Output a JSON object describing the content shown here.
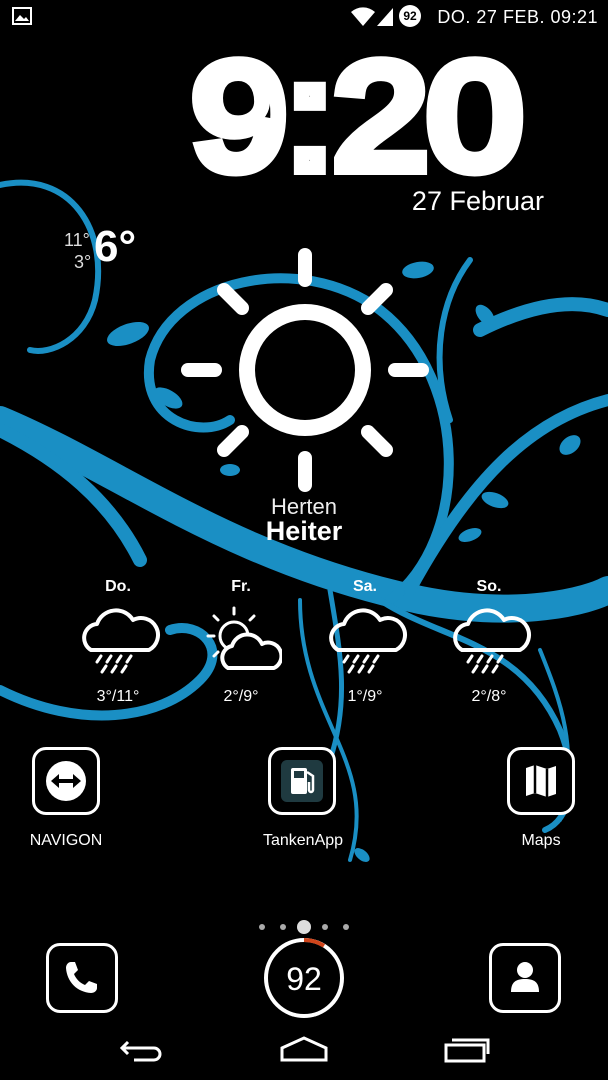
{
  "status_bar": {
    "battery_level": "92",
    "datetime": "DO. 27 FEB. 09:21"
  },
  "clock": {
    "time": "9:20",
    "date": "27 Februar"
  },
  "temperature": {
    "high": "11°",
    "low": "3°",
    "current": "6°"
  },
  "weather": {
    "location": "Herten",
    "condition": "Heiter",
    "icon": "sun-icon"
  },
  "forecast": [
    {
      "day": "Do.",
      "temp": "3°/11°",
      "icon": "rain-cloud-icon"
    },
    {
      "day": "Fr.",
      "temp": "2°/9°",
      "icon": "partly-cloudy-icon"
    },
    {
      "day": "Sa.",
      "temp": "1°/9°",
      "icon": "rain-cloud-icon"
    },
    {
      "day": "So.",
      "temp": "2°/8°",
      "icon": "rain-cloud-icon"
    }
  ],
  "apps": [
    {
      "label": "NAVIGON",
      "icon": "navigon-icon"
    },
    {
      "label": "TankenApp",
      "icon": "fuel-pump-icon"
    },
    {
      "label": "Maps",
      "icon": "map-icon"
    }
  ],
  "dock": {
    "phone_icon": "phone-icon",
    "battery_widget": "92",
    "contacts_icon": "contact-icon"
  },
  "colors": {
    "wallpaper_accent": "#1a8fc4",
    "background": "#000000",
    "foreground": "#ffffff"
  }
}
